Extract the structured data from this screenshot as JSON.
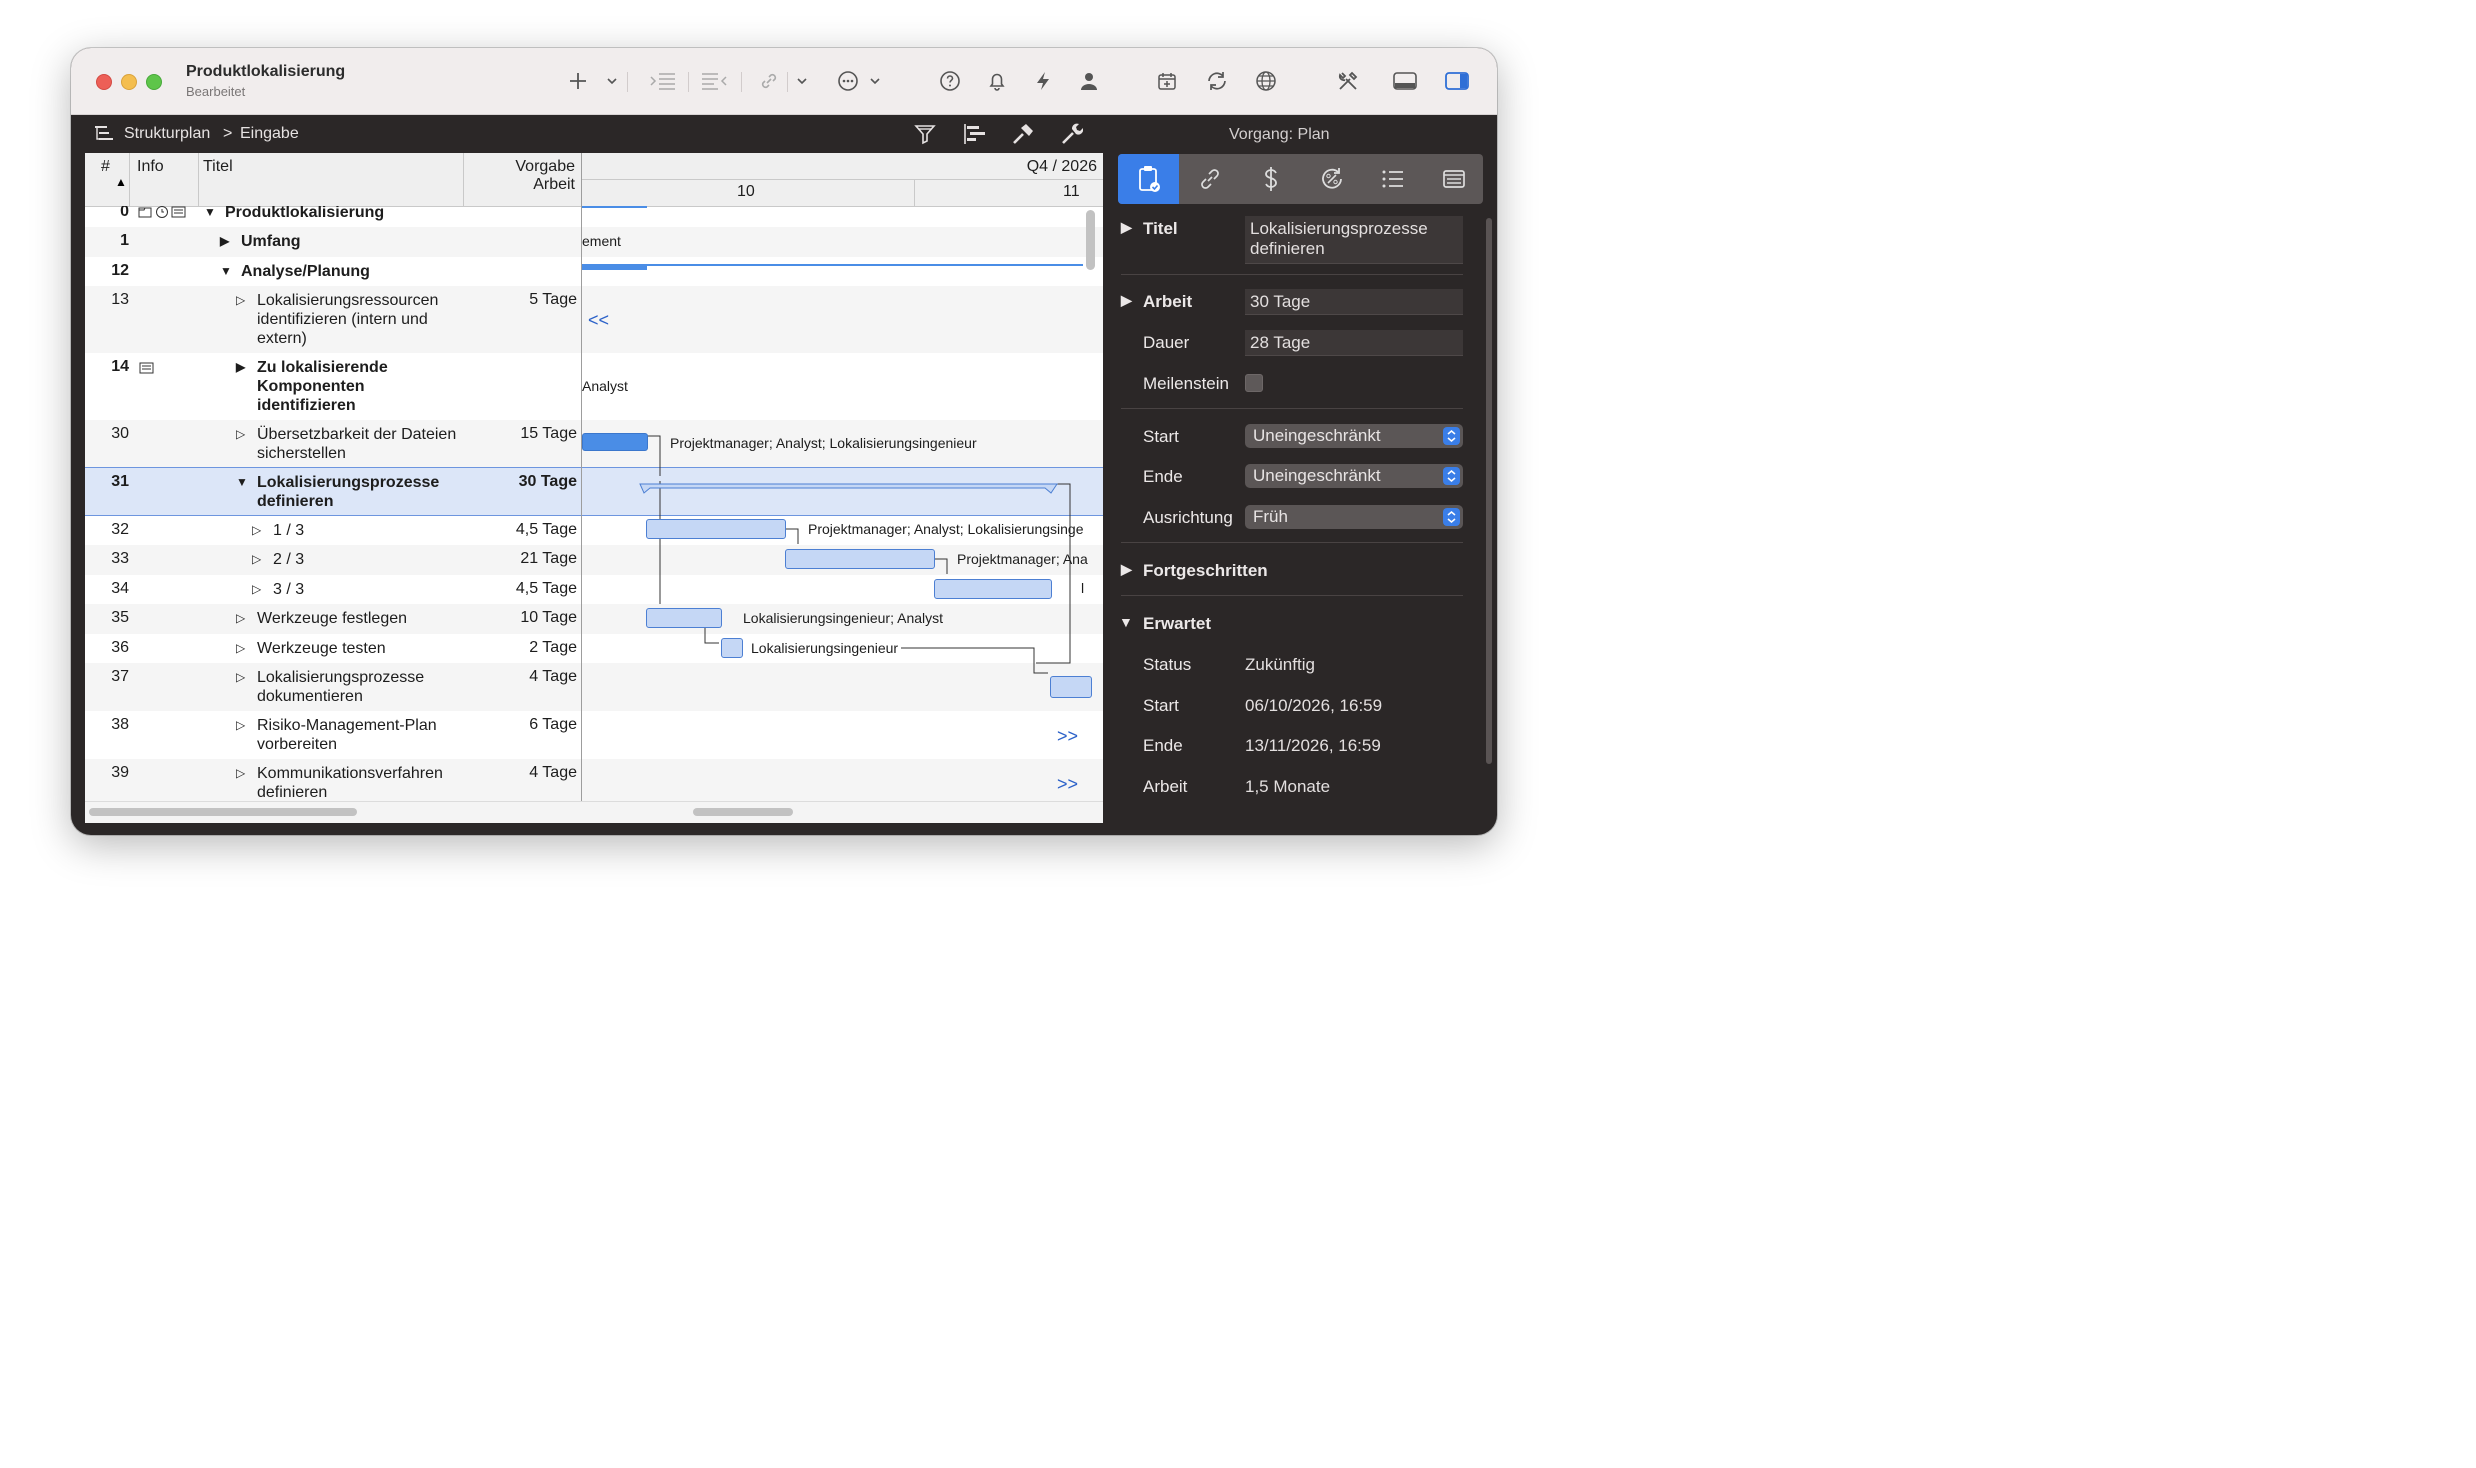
{
  "window": {
    "title": "Produktlokalisierung",
    "subtitle": "Bearbeitet"
  },
  "toolbar": {
    "icons": [
      "plus-icon",
      "chevron-down-icon",
      "indent-icon",
      "outdent-icon",
      "link-icon",
      "chevron-down-icon",
      "more-icon",
      "chevron-down-icon",
      "help-icon",
      "bell-icon",
      "lightning-icon",
      "person-icon",
      "add-calendar-icon",
      "refresh-icon",
      "globe-icon",
      "tools-icon",
      "bottom-panel-icon",
      "sidebar-icon"
    ]
  },
  "pathbar": {
    "crumb_root": "Strukturplan",
    "crumb_sep": ">",
    "crumb_leaf": "Eingabe",
    "inspector_label": "Vorgang:",
    "inspector_value": "Plan"
  },
  "outline": {
    "headers": {
      "num": "#",
      "info": "Info",
      "title": "Titel",
      "work_line1": "Vorgabe",
      "work_line2": "Arbeit"
    },
    "timescale": {
      "quarter": "Q4 / 2026",
      "week_a": "10",
      "week_b": "11"
    },
    "rows": [
      {
        "num": "0",
        "title": "Produktlokalisierung",
        "work": "",
        "gantt_label": ""
      },
      {
        "num": "1",
        "title": "Umfang",
        "work": "",
        "gantt_label": "ement"
      },
      {
        "num": "12",
        "title": "Analyse/Planung",
        "work": "",
        "gantt_label": ""
      },
      {
        "num": "13",
        "title": "Lokalisierungsressourcen identifizieren (intern und extern)",
        "work": "5 Tage",
        "gantt_label": "<<"
      },
      {
        "num": "14",
        "title": "Zu lokalisierende Komponenten identifizieren",
        "work": "",
        "gantt_label": "Analyst"
      },
      {
        "num": "30",
        "title": "Übersetzbarkeit der Dateien sicherstellen",
        "work": "15 Tage",
        "gantt_label": "Projektmanager; Analyst; Lokalisierungsingenieur"
      },
      {
        "num": "31",
        "title": "Lokalisierungsprozesse definieren",
        "work": "30 Tage",
        "gantt_label": ""
      },
      {
        "num": "32",
        "title": "1 / 3",
        "work": "4,5 Tage",
        "gantt_label": "Projektmanager; Analyst; Lokalisierungsinge"
      },
      {
        "num": "33",
        "title": "2 / 3",
        "work": "21 Tage",
        "gantt_label": "Projektmanager; Ana"
      },
      {
        "num": "34",
        "title": "3 / 3",
        "work": "4,5 Tage",
        "gantt_label": "l"
      },
      {
        "num": "35",
        "title": "Werkzeuge festlegen",
        "work": "10 Tage",
        "gantt_label": "Lokalisierungsingenieur; Analyst"
      },
      {
        "num": "36",
        "title": "Werkzeuge testen",
        "work": "2 Tage",
        "gantt_label": "Lokalisierungsingenieur"
      },
      {
        "num": "37",
        "title": "Lokalisierungsprozesse dokumentieren",
        "work": "4 Tage",
        "gantt_label": ""
      },
      {
        "num": "38",
        "title": "Risiko-Management-Plan vorbereiten",
        "work": "6 Tage",
        "gantt_label": ">>"
      },
      {
        "num": "39",
        "title": "Kommunikationsverfahren definieren",
        "work": "4 Tage",
        "gantt_label": ">>"
      }
    ]
  },
  "inspector": {
    "tabs": [
      "clipboard-icon",
      "link-icon",
      "dollar-icon",
      "percent-cycle-icon",
      "list-icon",
      "notes-icon"
    ],
    "titel_label": "Titel",
    "titel_value": "Lokalisierungsprozesse definieren",
    "arbeit_label": "Arbeit",
    "arbeit_value": "30 Tage",
    "dauer_label": "Dauer",
    "dauer_value": "28 Tage",
    "meilenstein_label": "Meilenstein",
    "meilenstein_checked": false,
    "start_label": "Start",
    "start_value": "Uneingeschränkt",
    "ende_label": "Ende",
    "ende_value": "Uneingeschränkt",
    "ausrichtung_label": "Ausrichtung",
    "ausrichtung_value": "Früh",
    "fortgeschritten_label": "Fortgeschritten",
    "erwartet_label": "Erwartet",
    "status_label": "Status",
    "status_value": "Zukünftig",
    "exp_start_label": "Start",
    "exp_start_value": "06/10/2026, 16:59",
    "exp_ende_label": "Ende",
    "exp_ende_value": "13/11/2026, 16:59",
    "exp_arbeit_label": "Arbeit",
    "exp_arbeit_value": "1,5 Monate"
  },
  "colors": {
    "accent": "#3a7ee8",
    "bar_fill": "#c5d7f5",
    "bar_border": "#4c7fd3",
    "selection": "#dce6f8",
    "window_dark": "#2b2727"
  }
}
